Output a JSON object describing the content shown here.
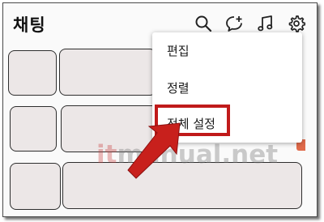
{
  "header": {
    "title": "채팅",
    "icons": [
      "search-icon",
      "new-chat-icon",
      "music-icon",
      "settings-gear-icon"
    ]
  },
  "menu": {
    "items": [
      {
        "label": "편집"
      },
      {
        "label": "정렬"
      },
      {
        "label": "전체 설정"
      }
    ],
    "highlighted_index": 2
  },
  "watermark": {
    "text_it": "it",
    "text_rest": "manual.net"
  },
  "colors": {
    "highlight": "#c01a1a",
    "arrow": "#c8201c",
    "placeholder_fill": "#ece7e7",
    "badge": "#e06a4a"
  }
}
